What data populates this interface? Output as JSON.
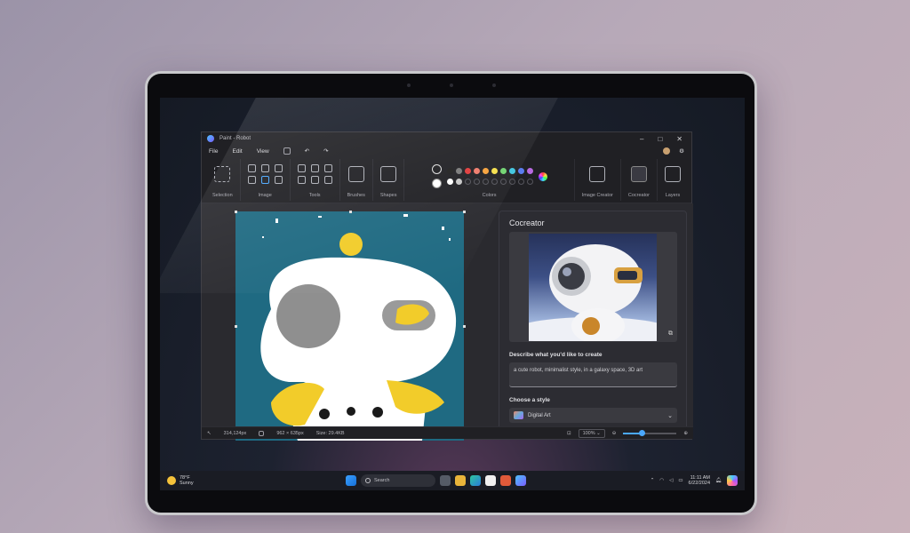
{
  "window": {
    "title": "Paint - Robot"
  },
  "menu": [
    "File",
    "Edit",
    "View"
  ],
  "ribbon": {
    "groups": {
      "selection": "Selection",
      "image": "Image",
      "tools": "Tools",
      "brushes": "Brushes",
      "shapes": "Shapes",
      "colors": "Colors",
      "image_creator": "Image Creator",
      "cocreator": "Cocreator",
      "layers": "Layers"
    },
    "current_colors": [
      "#1f1f22",
      "#ffffff"
    ],
    "palette_row1": [
      "#202020",
      "#7a7a7a",
      "#e23b3b",
      "#f07b6b",
      "#f7a23a",
      "#f6e04a",
      "#6fd36f",
      "#3ec6e0",
      "#5a7df0",
      "#b86ae0"
    ],
    "palette_row2": [
      "#ffffff",
      "#c8c8c8",
      "",
      "",
      "",
      "",
      "",
      "",
      "",
      ""
    ]
  },
  "cocreator": {
    "title": "Cocreator",
    "describe_label": "Describe what you'd like to create",
    "prompt": "a cute robot, minimalist style, in a galaxy space, 3D art",
    "style_label": "Choose a style",
    "style_value": "Digital Art"
  },
  "status": {
    "cursor": "314,124px",
    "selection": "962 × 635px",
    "size": "Size: 29.4KB",
    "zoom": "100%",
    "zoom_percent": 35
  },
  "taskbar": {
    "weather_temp": "78°F",
    "weather_desc": "Sunny",
    "search_placeholder": "Search",
    "time": "11:11 AM",
    "date": "6/22/2024"
  }
}
